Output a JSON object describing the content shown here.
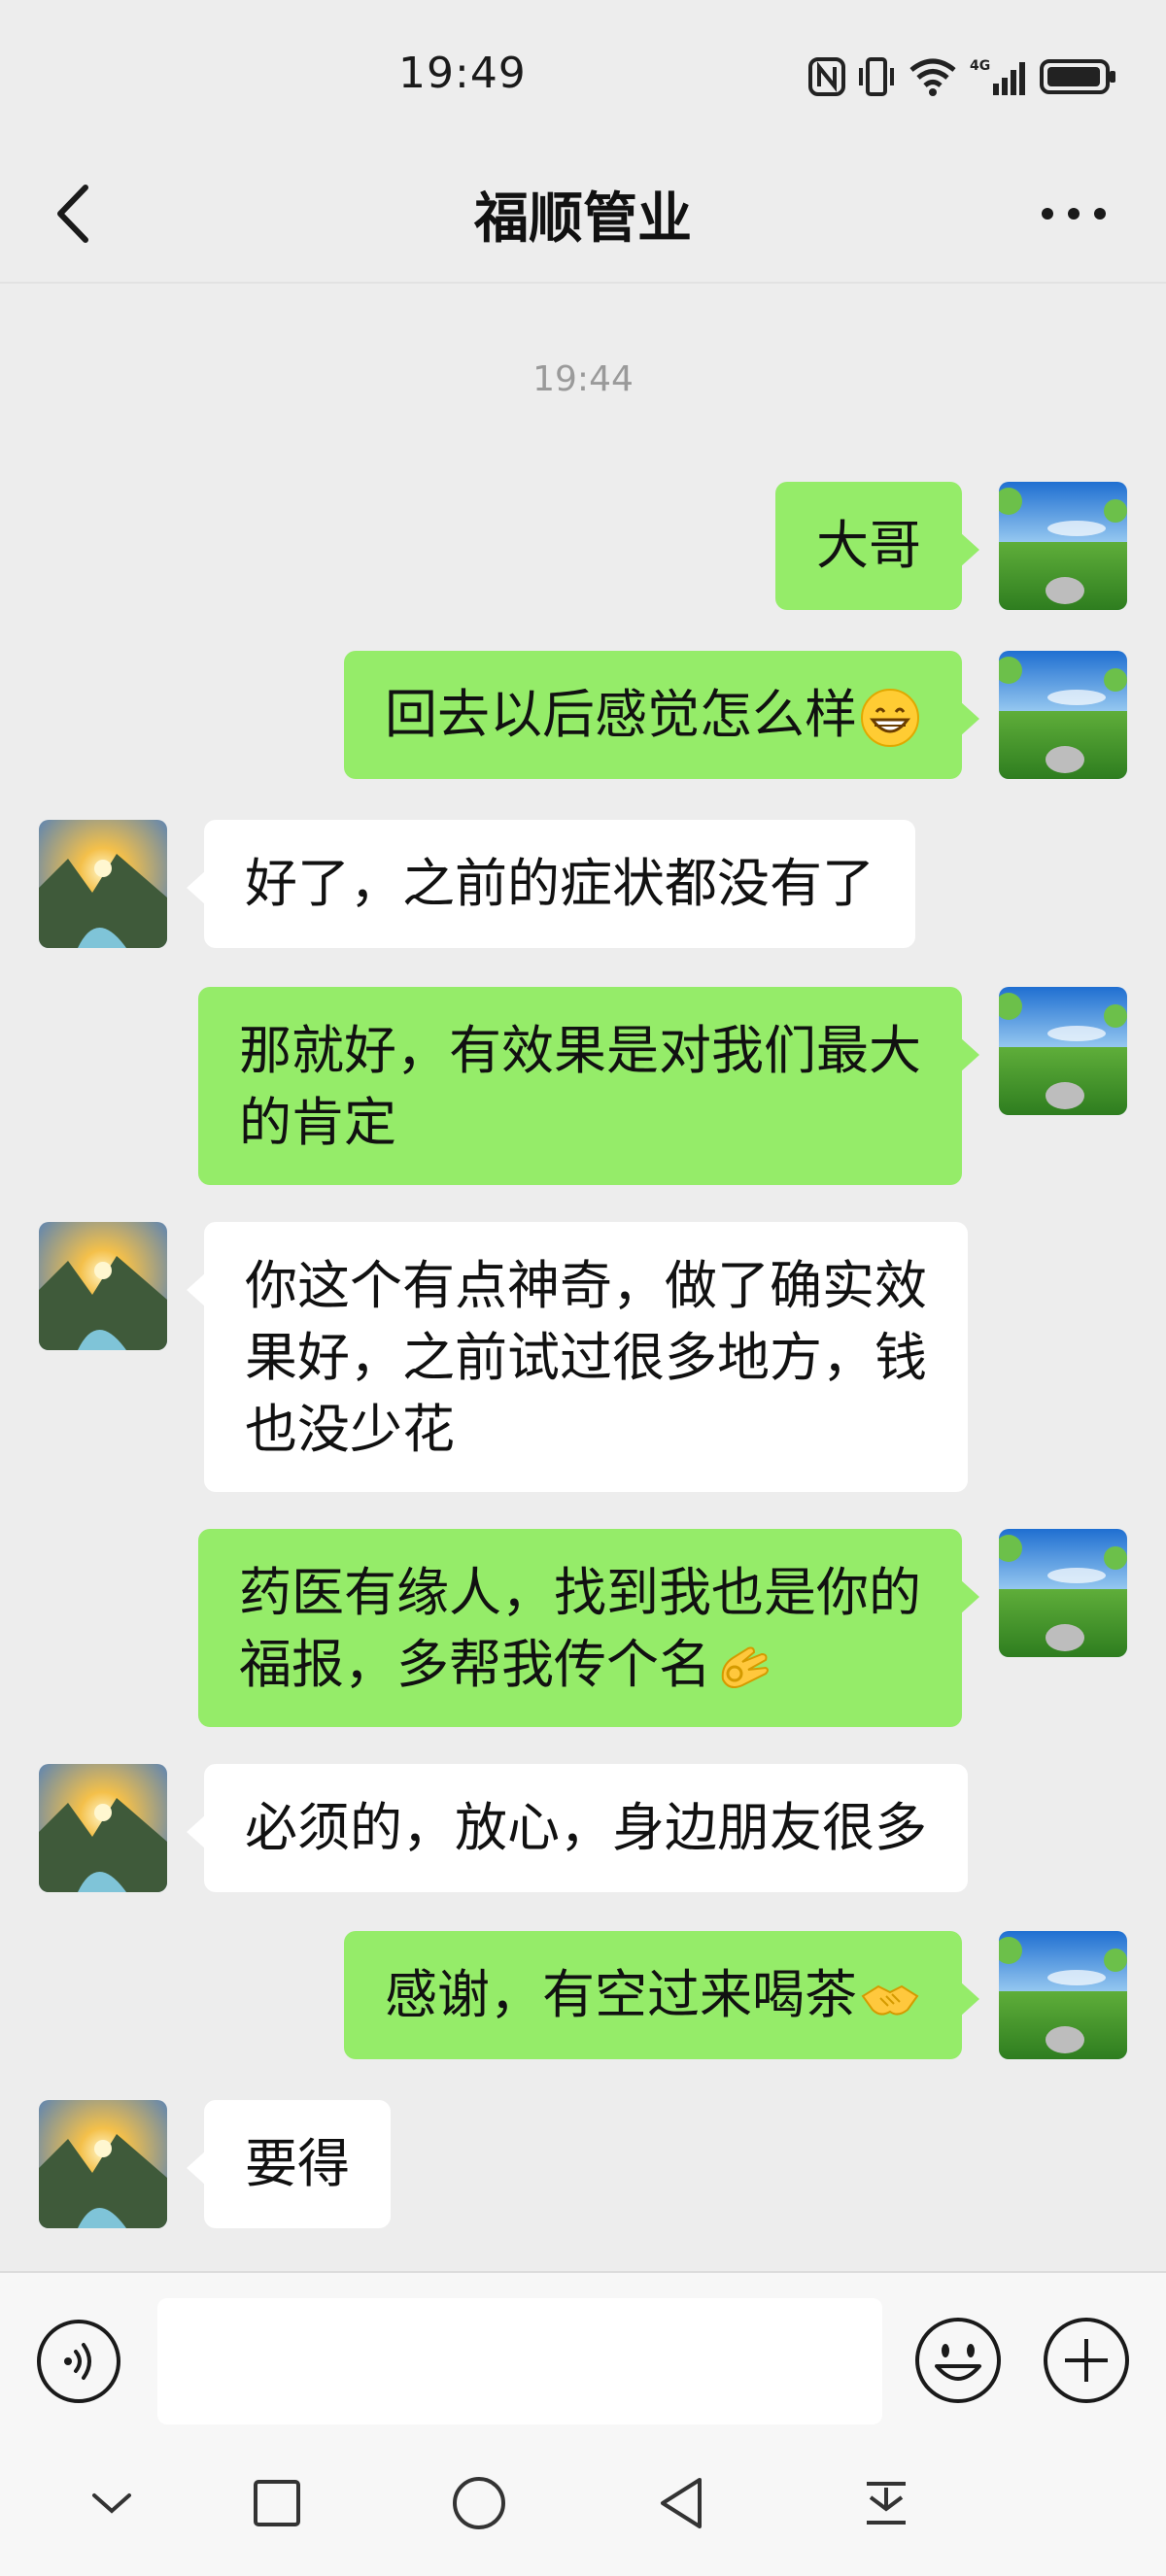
{
  "status_bar": {
    "time": "19:49",
    "icons": [
      "nfc-icon",
      "vibrate-icon",
      "wifi-icon",
      "signal-4g-icon",
      "battery-icon"
    ]
  },
  "header": {
    "title": "福顺管业",
    "back_icon": "chevron-left-icon",
    "more_icon": "more-dots-icon"
  },
  "chat": {
    "timestamp": "19:44",
    "messages": [
      {
        "sender": "self",
        "lines": [
          "大哥"
        ]
      },
      {
        "sender": "self",
        "lines": [
          "回去以后感觉怎么样"
        ],
        "emoji": "grin-emoji"
      },
      {
        "sender": "other",
        "lines": [
          "好了，之前的症状都没有了"
        ]
      },
      {
        "sender": "self",
        "lines": [
          "那就好，有效果是对我们最大",
          "的肯定"
        ]
      },
      {
        "sender": "other",
        "lines": [
          "你这个有点神奇，做了确实效",
          "果好，之前试过很多地方，钱",
          "也没少花"
        ]
      },
      {
        "sender": "self",
        "lines": [
          "药医有缘人，找到我也是你的",
          "福报，多帮我传个名"
        ],
        "emoji": "ok-hand-emoji"
      },
      {
        "sender": "other",
        "lines": [
          "必须的，放心，身边朋友很多"
        ]
      },
      {
        "sender": "self",
        "lines": [
          "感谢，有空过来喝茶"
        ],
        "emoji": "handshake-emoji"
      },
      {
        "sender": "other",
        "lines": [
          "要得"
        ]
      }
    ]
  },
  "input_bar": {
    "voice_icon": "voice-icon",
    "message_value": "",
    "emoji_icon": "smiley-icon",
    "plus_icon": "plus-icon"
  },
  "system_nav": {
    "icons": [
      "chevron-down-icon",
      "recents-square-icon",
      "home-circle-icon",
      "back-triangle-icon",
      "notification-pulldown-icon"
    ]
  },
  "colors": {
    "background": "#ededed",
    "self_bubble": "#95ec69",
    "other_bubble": "#ffffff",
    "timestamp_text": "#9a9a9a"
  }
}
